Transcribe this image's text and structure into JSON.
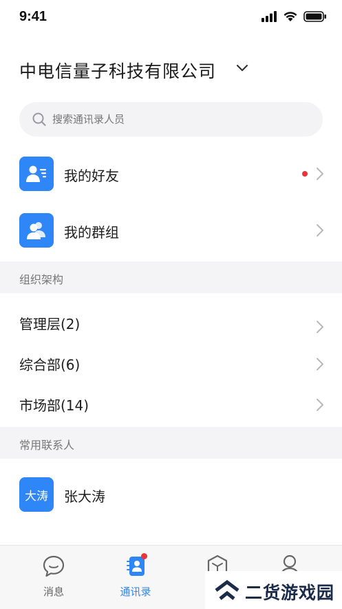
{
  "status_bar": {
    "time": "9:41"
  },
  "header": {
    "company": "中电信量子科技有限公司"
  },
  "search": {
    "placeholder": "搜索通讯录人员"
  },
  "quick_links": [
    {
      "label": "我的好友",
      "icon": "add-contact-icon",
      "unread": true
    },
    {
      "label": "我的群组",
      "icon": "group-icon",
      "unread": false
    }
  ],
  "org_section": {
    "title": "组织架构"
  },
  "departments": [
    "管理层(2)",
    "综合部(6)",
    "市场部(14)"
  ],
  "frequent_section": {
    "title": "常用联系人"
  },
  "contacts": [
    {
      "avatar_text": "大涛",
      "name": "张大涛"
    }
  ],
  "tabbar": {
    "tabs": [
      {
        "label": "消息",
        "icon": "chat-bubble-icon",
        "active": false
      },
      {
        "label": "通讯录",
        "icon": "contacts-icon",
        "active": true,
        "badge": true
      },
      {
        "label": "",
        "icon": "cube-icon",
        "active": false
      },
      {
        "label": "",
        "icon": "person-icon",
        "active": false
      }
    ]
  },
  "watermark": {
    "text": "二货游戏园"
  },
  "colors": {
    "accent": "#2f86f6",
    "badge": "#e8343a",
    "section_bg": "#f4f4f6"
  }
}
